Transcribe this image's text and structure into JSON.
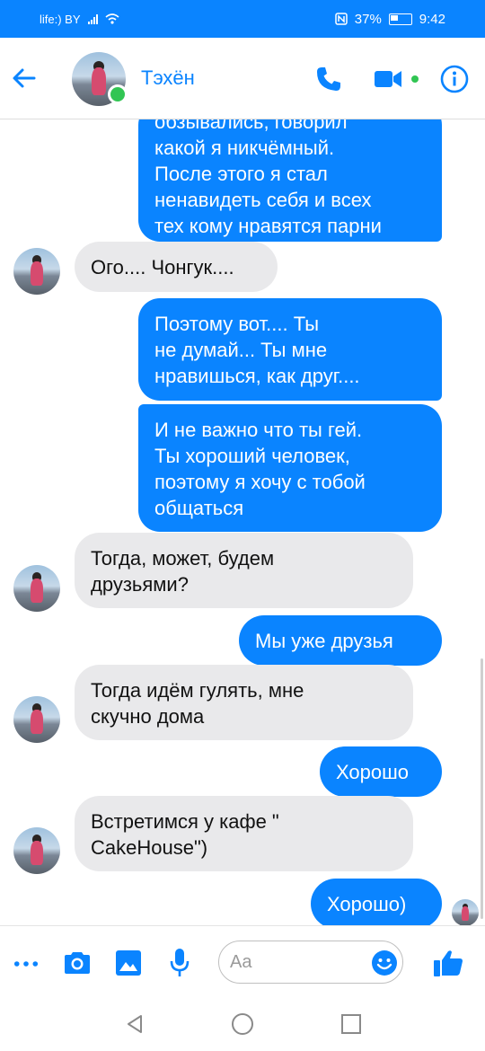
{
  "status_bar": {
    "carrier": "life:) BY",
    "battery": "37%",
    "time": "9:42"
  },
  "header": {
    "contact_name": "Тэхён"
  },
  "messages": [
    {
      "dir": "out",
      "text": "обзывались, говорил\nкакой я  никчёмный.\nПосле этого я стал\nненавидеть себя и всех\nтех кому нравятся парни"
    },
    {
      "dir": "in",
      "text": "Ого.... Чонгук...."
    },
    {
      "dir": "out",
      "text": "Поэтому вот.... Ты\nне думай... Ты мне\nнравишься, как друг...."
    },
    {
      "dir": "out",
      "text": "И не важно что ты гей.\nТы хороший человек,\nпоэтому я хочу с тобой\nобщаться"
    },
    {
      "dir": "in",
      "text": "Тогда, может, будем\nдрузьями?"
    },
    {
      "dir": "out",
      "text": "Мы уже друзья"
    },
    {
      "dir": "in",
      "text": "Тогда идём гулять, мне\nскучно дома"
    },
    {
      "dir": "out",
      "text": "Хорошо"
    },
    {
      "dir": "in",
      "text": "Встретимся у кафе \"\nCakeHouse\")"
    },
    {
      "dir": "out",
      "text": "Хорошо)"
    }
  ],
  "composer": {
    "placeholder": "Aa"
  },
  "colors": {
    "accent": "#0a84ff",
    "incoming_bubble": "#e9e9eb",
    "online": "#31c553"
  }
}
